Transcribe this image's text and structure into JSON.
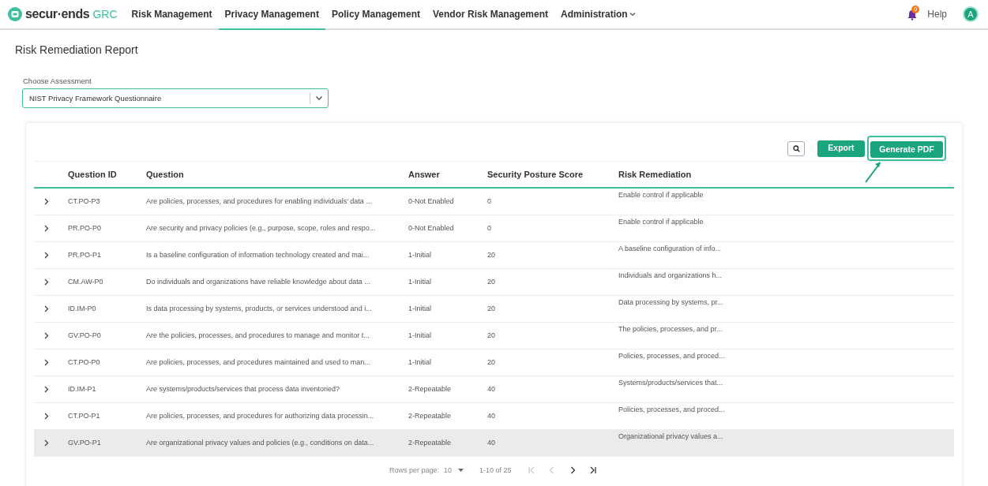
{
  "nav": {
    "logo": "secur·ends",
    "logo_suffix": "GRC",
    "items": [
      {
        "label": "Risk Management",
        "selected": false
      },
      {
        "label": "Privacy Management",
        "selected": true
      },
      {
        "label": "Policy Management",
        "selected": false
      },
      {
        "label": "Vendor Risk Management",
        "selected": false
      },
      {
        "label": "Administration",
        "selected": false,
        "dropdown": true
      }
    ],
    "notification_count": "0",
    "help": "Help",
    "avatar": "A"
  },
  "page_title": "Risk Remediation Report",
  "assessment": {
    "label": "Choose Assessment",
    "value": "NIST Privacy Framework Questionnaire"
  },
  "toolbar": {
    "buttons": [
      "Export",
      "Generate PDF"
    ]
  },
  "table": {
    "columns": [
      "Question ID",
      "Question",
      "Answer",
      "Security Posture Score",
      "Risk Remediation"
    ],
    "rows": [
      {
        "id": "CT.PO-P3",
        "question": "Are policies, processes, and procedures for enabling individuals' data ...",
        "answer": "0-Not Enabled",
        "score": "0",
        "remediation": "Enable control if applicable",
        "selected": false
      },
      {
        "id": "PR.PO-P0",
        "question": "Are security and privacy policies (e.g., purpose, scope, roles and respo...",
        "answer": "0-Not Enabled",
        "score": "0",
        "remediation": "Enable control if applicable",
        "selected": false
      },
      {
        "id": "PR.PO-P1",
        "question": "Is a baseline configuration of information technology created and mai...",
        "answer": "1-Initial",
        "score": "20",
        "remediation": "A baseline configuration of info...",
        "selected": false
      },
      {
        "id": "CM.AW-P0",
        "question": "Do individuals and organizations have reliable knowledge about data ...",
        "answer": "1-Initial",
        "score": "20",
        "remediation": "Individuals and organizations h...",
        "selected": false
      },
      {
        "id": "ID.IM-P0",
        "question": "Is data processing by systems, products, or services understood and i...",
        "answer": "1-Initial",
        "score": "20",
        "remediation": "Data processing by systems, pr...",
        "selected": false
      },
      {
        "id": "GV.PO-P0",
        "question": "Are the policies, processes, and procedures to manage and monitor t...",
        "answer": "1-Initial",
        "score": "20",
        "remediation": "The policies, processes, and pr...",
        "selected": false
      },
      {
        "id": "CT.PO-P0",
        "question": "Are policies, processes, and procedures maintained and used to man...",
        "answer": "1-Initial",
        "score": "20",
        "remediation": "Policies, processes, and proced...",
        "selected": false
      },
      {
        "id": "ID.IM-P1",
        "question": "Are systems/products/services that process data inventoried?",
        "answer": "2-Repeatable",
        "score": "40",
        "remediation": "Systems/products/services that...",
        "selected": false
      },
      {
        "id": "CT.PO-P1",
        "question": "Are policies, processes, and procedures for authorizing data processin...",
        "answer": "2-Repeatable",
        "score": "40",
        "remediation": "Policies, processes, and proced...",
        "selected": false
      },
      {
        "id": "GV.PO-P1",
        "question": "Are organizational privacy values and policies (e.g., conditions on data...",
        "answer": "2-Repeatable",
        "score": "40",
        "remediation": "Organizational privacy values a...",
        "selected": true
      }
    ]
  },
  "pagination": {
    "rows_per_page_label": "Rows per page:",
    "rows_per_page": "10",
    "range": "1-10 of 25",
    "first_disabled": true,
    "prev_disabled": true,
    "next_disabled": false,
    "last_disabled": false
  }
}
